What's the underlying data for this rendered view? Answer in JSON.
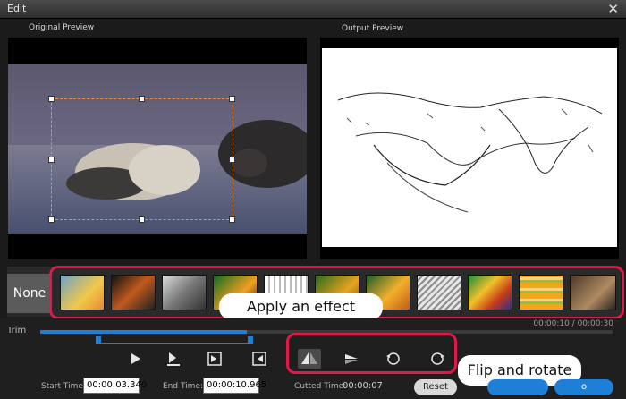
{
  "window": {
    "title": "Edit",
    "close_glyph": "✕"
  },
  "preview": {
    "original_label": "Original Preview",
    "output_label": "Output Preview"
  },
  "effects": {
    "none_label": "None",
    "thumbnails": [
      "effect-1",
      "effect-2",
      "effect-3",
      "effect-4",
      "effect-5",
      "effect-6",
      "effect-7",
      "effect-8",
      "effect-9",
      "effect-10",
      "effect-11"
    ]
  },
  "callouts": {
    "effect": "Apply an effect",
    "flip": "Flip and rotate"
  },
  "trim": {
    "label": "Trim",
    "time_display": "00:00:10 / 00:00:30"
  },
  "times": {
    "start_label": "Start Time:",
    "start_value": "00:00:03.340",
    "end_label": "End Time:",
    "end_value": "00:00:10.965",
    "cut_label": "Cutted Time:",
    "cut_value": "00:00:07"
  },
  "buttons": {
    "reset": "Reset",
    "next": "",
    "right": "o"
  },
  "colors": {
    "accent": "#1e7fd8",
    "callout_ring": "#e0184b",
    "crop": "#ff8c1a"
  }
}
